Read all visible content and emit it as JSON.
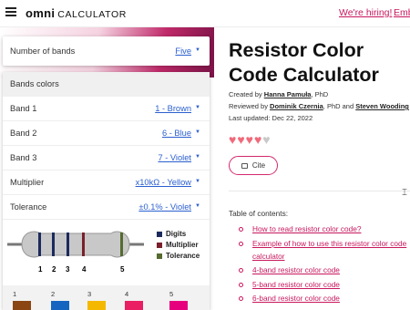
{
  "header": {
    "logo_brand": "omni",
    "logo_sub": "CALCULATOR",
    "hiring_link": "We're hiring!",
    "embed_link": "Emb"
  },
  "calculator": {
    "number_of_bands": {
      "label": "Number of bands",
      "value": "Five"
    },
    "section_title": "Bands colors",
    "rows": [
      {
        "label": "Band 1",
        "value": "1 - Brown"
      },
      {
        "label": "Band 2",
        "value": "6 - Blue"
      },
      {
        "label": "Band 3",
        "value": "7 - Violet"
      },
      {
        "label": "Multiplier",
        "value": "x10kΩ - Yellow"
      },
      {
        "label": "Tolerance",
        "value": "±0.1% - Violet"
      }
    ],
    "resistor_numbers": [
      "1",
      "2",
      "3",
      "4",
      "5"
    ],
    "legend": [
      {
        "label": "Digits",
        "color": "#1b2a5e"
      },
      {
        "label": "Multiplier",
        "color": "#7a1f2b"
      },
      {
        "label": "Tolerance",
        "color": "#556b2f"
      }
    ],
    "column_numbers": [
      "1",
      "2",
      "3",
      "4",
      "5"
    ],
    "column_colors": [
      "#8b4513",
      "#1565c0",
      "#f5b800",
      "#e91e63",
      "#e6007e"
    ]
  },
  "article": {
    "title": "Resistor Color Code Calculator",
    "created_prefix": "Created by ",
    "created_author": "Hanna Pamuła",
    "created_suffix": ", PhD",
    "reviewed_prefix": "Reviewed by ",
    "reviewer1": "Dominik Czernia",
    "reviewed_mid": ", PhD and ",
    "reviewer2": "Steven Wooding",
    "updated": "Last updated: Dec 22, 2022",
    "cite_label": "Cite",
    "toc_title": "Table of contents:",
    "toc": [
      "How to read resistor color code?",
      "Example of how to use this resistor color code calculator",
      "4-band resistor color code",
      "5-band resistor color code",
      "6-band resistor color code"
    ]
  },
  "colors": {
    "accent": "#c8175d",
    "link": "#2a5fd0",
    "heart": "#f06a7a",
    "heart_empty": "#c9c9c9"
  }
}
